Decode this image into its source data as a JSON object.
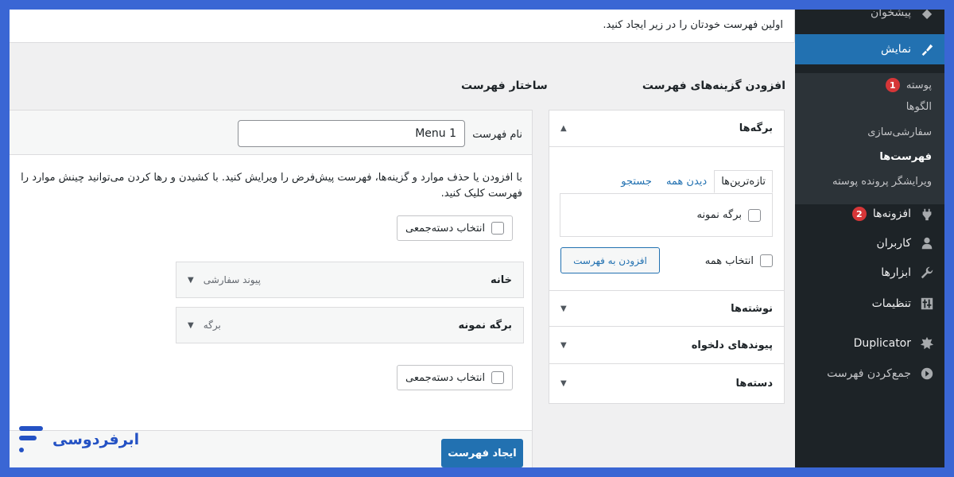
{
  "notice": {
    "text": "اولین فهرست خودتان را در زیر ایجاد کنید."
  },
  "headings": {
    "add_items": "افزودن گزینه‌های فهرست",
    "structure": "ساختار فهرست"
  },
  "sidebar": {
    "top_partial": "پیشخوان",
    "items": [
      {
        "label": "نمایش",
        "icon": "brush-icon",
        "active": true
      },
      {
        "label": "افزونه‌ها",
        "icon": "plugin-icon",
        "badge": "2"
      },
      {
        "label": "کاربران",
        "icon": "users-icon"
      },
      {
        "label": "ابزارها",
        "icon": "wrench-icon"
      },
      {
        "label": "تنظیمات",
        "icon": "settings-icon"
      },
      {
        "label": "Duplicator",
        "icon": "duplicator-icon"
      },
      {
        "label": "جمع‌کردن فهرست",
        "icon": "collapse-icon"
      }
    ],
    "submenu": [
      {
        "label": "پوسته",
        "badge": "1"
      },
      {
        "label": "الگوها"
      },
      {
        "label": "سفارشی‌سازی"
      },
      {
        "label": "فهرست‌ها",
        "current": true
      },
      {
        "label": "ویرایشگر پرونده پوسته"
      }
    ]
  },
  "add_panel": {
    "pages_title": "برگه‌ها",
    "tabs": [
      "تازه‌ترین‌ها",
      "دیدن همه",
      "جستجو"
    ],
    "page_item": "برگه نمونه",
    "select_all": "انتخاب همه",
    "add_button": "افزودن به فهرست",
    "sections": [
      "نوشته‌ها",
      "پیوندهای دلخواه",
      "دسته‌ها"
    ]
  },
  "structure": {
    "name_label": "نام فهرست",
    "name_value": "Menu 1",
    "desc_line1": "با افزودن یا حذف موارد و گزینه‌ها، فهرست پیش‌فرض را ویرایش کنید. با کشیدن و رها کردن می‌توانید چینش موارد را",
    "desc_line2": "فهرست کلیک کنید.",
    "bulk_select": "انتخاب دسته‌جمعی",
    "items": [
      {
        "title": "خانه",
        "type": "پیوند سفارشی"
      },
      {
        "title": "برگه نمونه",
        "type": "برگه"
      }
    ],
    "create_button": "ایجاد فهرست"
  },
  "brand": {
    "name": "ابرفردوسی",
    "color": "#2452c4"
  },
  "colors": {
    "accent": "#2271b1",
    "sidebar_bg": "#1d2327",
    "badge": "#d63638"
  }
}
